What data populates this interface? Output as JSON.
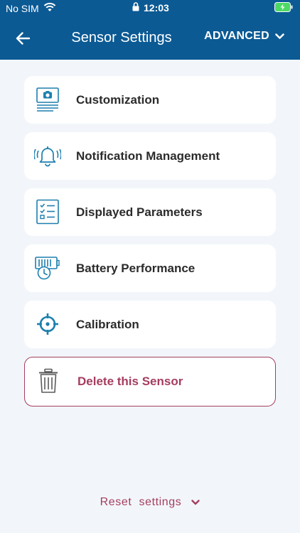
{
  "status_bar": {
    "carrier": "No SIM",
    "time": "12:03"
  },
  "header": {
    "title": "Sensor Settings",
    "advanced_label": "ADVANCED"
  },
  "menu": {
    "items": [
      {
        "label": "Customization",
        "icon": "customization-icon"
      },
      {
        "label": "Notification Management",
        "icon": "bell-icon"
      },
      {
        "label": "Displayed Parameters",
        "icon": "checklist-icon"
      },
      {
        "label": "Battery Performance",
        "icon": "battery-clock-icon"
      },
      {
        "label": "Calibration",
        "icon": "crosshair-icon"
      }
    ],
    "delete_label": "Delete this Sensor"
  },
  "footer": {
    "reset_label": "Reset  settings"
  },
  "colors": {
    "header_bg": "#0b5a94",
    "accent": "#1d7fae",
    "danger": "#a53d5e",
    "page_bg": "#f2f6fa"
  }
}
